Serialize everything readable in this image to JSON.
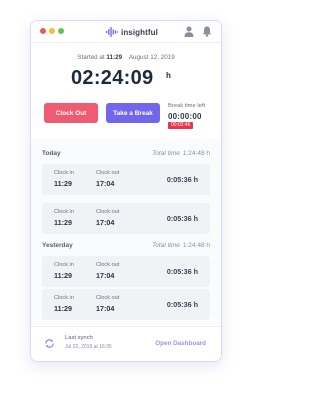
{
  "app": {
    "name": "insightful",
    "brand_color": "#6c63ea"
  },
  "window_controls": [
    "close",
    "minimize",
    "maximize"
  ],
  "header": {
    "icons": [
      "user-icon",
      "bell-icon"
    ]
  },
  "session": {
    "started_label": "Started at",
    "started_time": "11:29",
    "started_date": "August 12, 2019",
    "elapsed": "02:24:09",
    "elapsed_unit": "h"
  },
  "actions": {
    "clock_out": "Clock Out",
    "take_break": "Take a Break"
  },
  "break_info": {
    "label": "Break time left",
    "time": "00:00:00",
    "overtime": "00:02:46"
  },
  "sections": [
    {
      "title": "Today",
      "total_label": "Total time",
      "total_value": "1:24:48 h",
      "entries": [
        {
          "in_label": "Clock in",
          "in": "11:29",
          "out_label": "Clock out",
          "out": "17:04",
          "duration": "0:05:36 h"
        },
        {
          "in_label": "Clock in",
          "in": "11:29",
          "out_label": "Clock out",
          "out": "17:04",
          "duration": "0:05:36 h"
        }
      ]
    },
    {
      "title": "Yesterday",
      "total_label": "Total time",
      "total_value": "1:24:48 h",
      "entries": [
        {
          "in_label": "Clock in",
          "in": "11:29",
          "out_label": "Clock out",
          "out": "17:04",
          "duration": "0:05:36 h"
        },
        {
          "in_label": "Clock in",
          "in": "11:29",
          "out_label": "Clock out",
          "out": "17:04",
          "duration": "0:05:36 h"
        }
      ]
    }
  ],
  "footer": {
    "sync_label": "Last synch",
    "sync_time": "Jul 22, 2019 at 16:35",
    "open_dashboard": "Open Dashboard"
  },
  "colors": {
    "clock_out": "#ef5b72",
    "break": "#7266ea",
    "overtime_badge": "#e8354a",
    "link": "#9b93ea"
  }
}
